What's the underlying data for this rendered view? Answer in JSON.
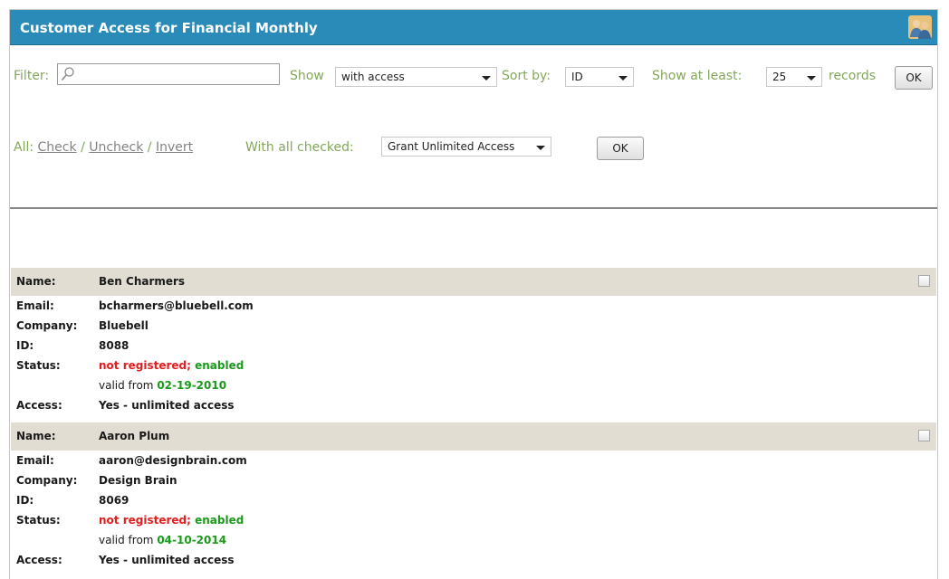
{
  "header": {
    "title": "Customer Access for Financial Monthly",
    "icon": "users-icon"
  },
  "toolbar": {
    "filter_label": "Filter:",
    "filter_value": "",
    "show_label": "Show",
    "show_value": "with access",
    "sort_label": "Sort by:",
    "sort_value": "ID",
    "atleast_label": "Show at least:",
    "atleast_value": "25",
    "records_label": "records",
    "ok_label": "OK"
  },
  "bulk": {
    "all_label": "All:",
    "check": "Check",
    "uncheck": "Uncheck",
    "invert": "Invert",
    "sep": "/",
    "with_all_label": "With all checked:",
    "action_value": "Grant Unlimited Access",
    "ok_label": "OK"
  },
  "fields": {
    "name": "Name:",
    "email": "Email:",
    "company": "Company:",
    "id": "ID:",
    "status": "Status:",
    "access": "Access:"
  },
  "records": [
    {
      "name": "Ben Charmers",
      "email": "bcharmers@bluebell.com",
      "company": "Bluebell",
      "id": "8088",
      "status_reg": "not registered;",
      "status_enabled": "enabled",
      "valid_from_label": "valid from",
      "valid_from": "02-19-2010",
      "access": "Yes - unlimited access"
    },
    {
      "name": "Aaron Plum",
      "email": "aaron@designbrain.com",
      "company": "Design Brain",
      "id": "8069",
      "status_reg": "not registered;",
      "status_enabled": "enabled",
      "valid_from_label": "valid from",
      "valid_from": "04-10-2014",
      "access": "Yes - unlimited access"
    }
  ],
  "colors": {
    "titlebar": "#2a8ab8",
    "label_green": "#83a85a",
    "record_header": "#e1ddd2",
    "status_red": "#e02020",
    "status_green": "#1a9a1a"
  }
}
